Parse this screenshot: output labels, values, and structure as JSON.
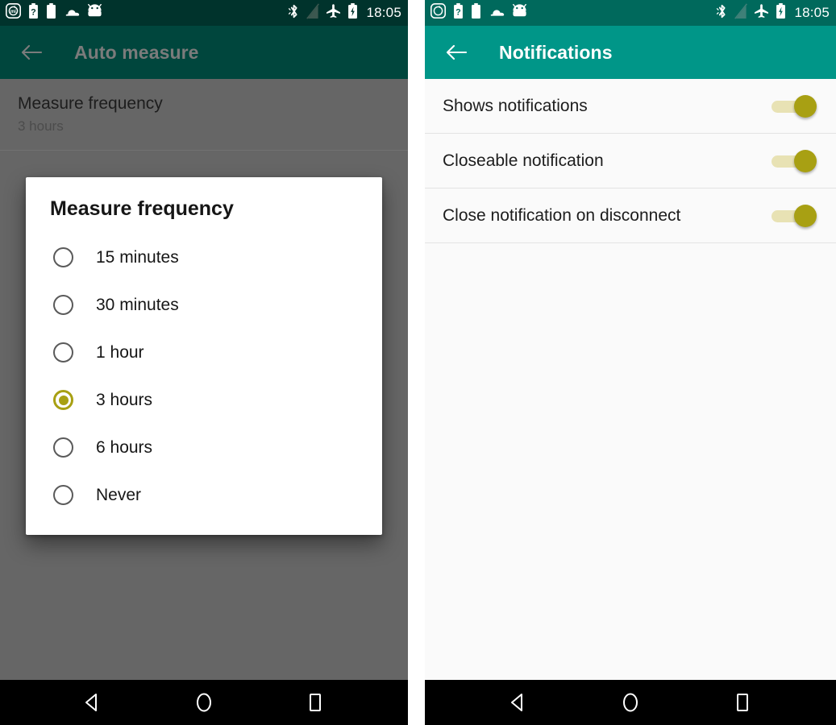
{
  "status_bar": {
    "time": "18:05",
    "left_icons": [
      "app-mi-icon",
      "battery-unknown-icon",
      "battery-icon",
      "cloud-icon",
      "android-head-icon"
    ],
    "right_icons": [
      "bluetooth-icon",
      "no-sim-icon",
      "airplane-mode-icon",
      "battery-charging-icon"
    ],
    "colors": {
      "dark_bg": "#00332c",
      "light_bg": "#00695c",
      "text": "#ffffff"
    }
  },
  "left_phone": {
    "app_bar": {
      "title": "Auto measure",
      "back_icon": "arrow-back-icon",
      "bg": "#00463d",
      "title_color": "#7b7b7b"
    },
    "preference": {
      "title": "Measure frequency",
      "summary": "3 hours"
    },
    "dialog": {
      "title": "Measure frequency",
      "selected_index": 3,
      "options": [
        {
          "label": "15 minutes",
          "checked": false
        },
        {
          "label": "30 minutes",
          "checked": false
        },
        {
          "label": "1 hour",
          "checked": false
        },
        {
          "label": "3 hours",
          "checked": true
        },
        {
          "label": "6 hours",
          "checked": false
        },
        {
          "label": "Never",
          "checked": false
        }
      ],
      "accent_color": "#a8a013"
    },
    "scrim_color": "#666666"
  },
  "right_phone": {
    "app_bar": {
      "title": "Notifications",
      "back_icon": "arrow-back-icon",
      "bg": "#009688",
      "title_color": "#ffffff"
    },
    "switches": [
      {
        "label": "Shows notifications",
        "on": true
      },
      {
        "label": "Closeable notification",
        "on": true
      },
      {
        "label": "Close notification on disconnect",
        "on": true
      }
    ],
    "switch_colors": {
      "track_on": "#e8e2b4",
      "thumb_on": "#a8a013"
    },
    "body_bg": "#fafafa"
  },
  "nav_bar": {
    "bg": "#000000",
    "buttons": [
      {
        "name": "back-nav-icon",
        "label": "Back"
      },
      {
        "name": "home-nav-icon",
        "label": "Home"
      },
      {
        "name": "recents-nav-icon",
        "label": "Recents"
      }
    ]
  }
}
